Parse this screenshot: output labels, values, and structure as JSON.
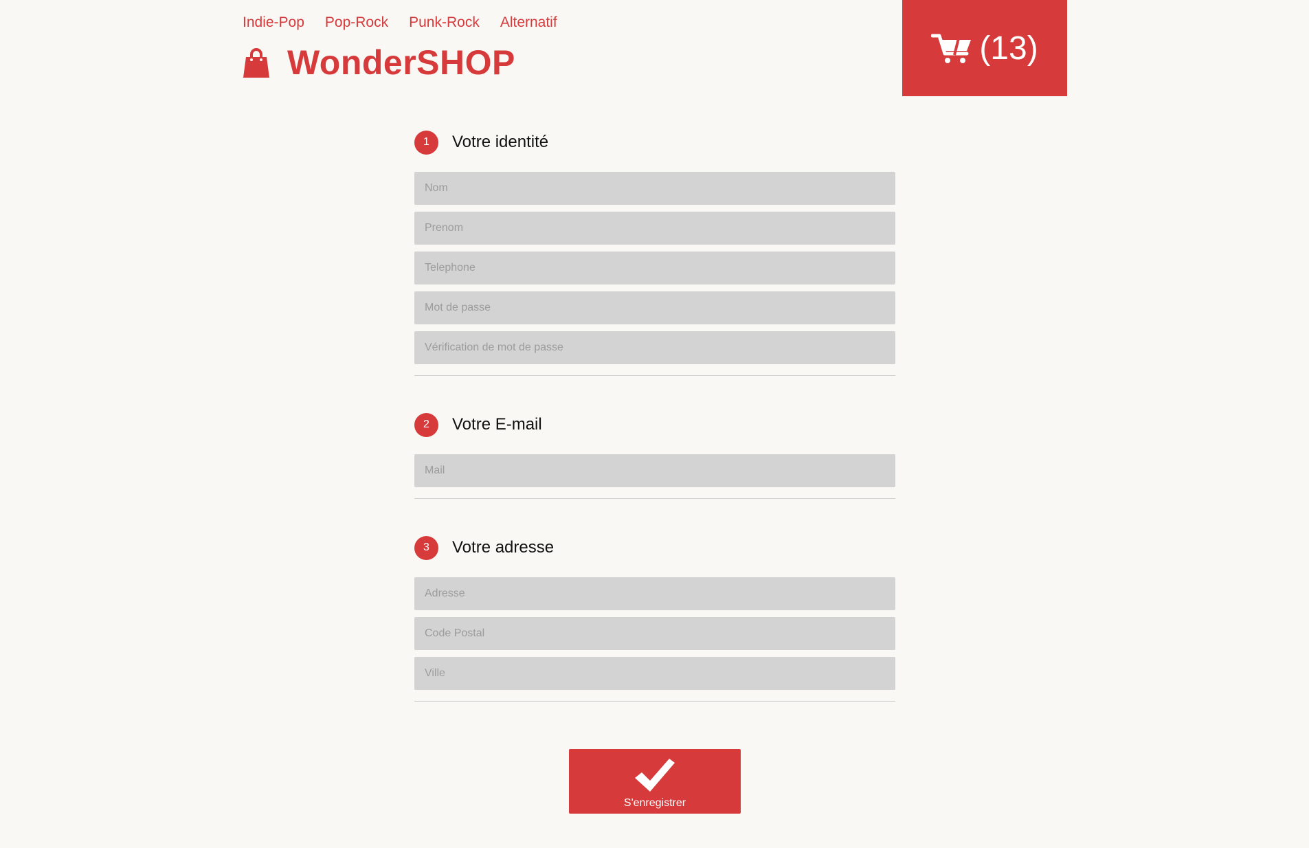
{
  "nav": {
    "links": [
      "Indie-Pop",
      "Pop-Rock",
      "Punk-Rock",
      "Alternatif"
    ]
  },
  "brand": {
    "name": "WonderSHOP",
    "icon": "shopping-bag-icon"
  },
  "cart": {
    "icon": "cart-icon",
    "count": "(13)"
  },
  "sections": [
    {
      "number": "1",
      "title": "Votre identité",
      "fields": [
        "Nom",
        "Prenom",
        "Telephone",
        "Mot de passe",
        "Vérification de mot de passe"
      ]
    },
    {
      "number": "2",
      "title": "Votre E-mail",
      "fields": [
        "Mail"
      ]
    },
    {
      "number": "3",
      "title": "Votre adresse",
      "fields": [
        "Adresse",
        "Code Postal",
        "Ville"
      ]
    }
  ],
  "submit": {
    "icon": "checkmark-icon",
    "label": "S'enregistrer"
  },
  "colors": {
    "accent": "#d63a3a",
    "background": "#f9f8f4",
    "field": "#d3d3d3"
  }
}
